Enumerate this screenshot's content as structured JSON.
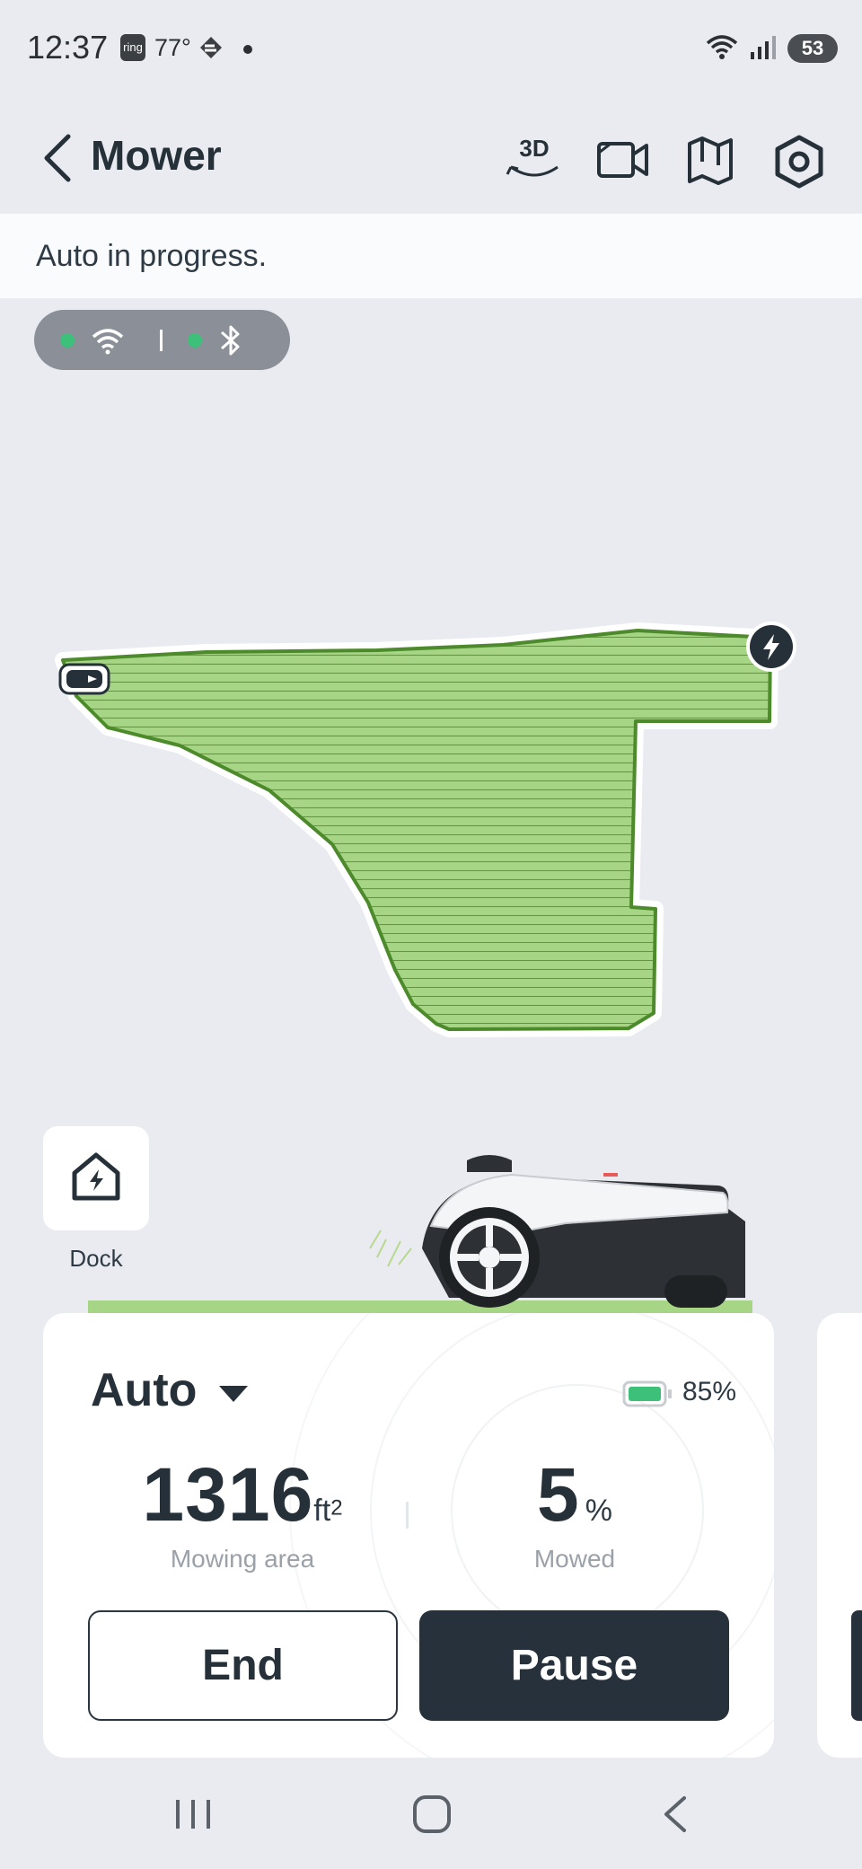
{
  "status_bar": {
    "time": "12:37",
    "ring_badge": "ring",
    "temperature": "77°",
    "battery": "53",
    "icons": [
      "ring-icon",
      "weather-icon",
      "wifi-icon",
      "signal-icon"
    ]
  },
  "header": {
    "title": "Mower",
    "actions": [
      "back-icon",
      "3d-view-icon",
      "camera-icon",
      "map-icon",
      "settings-icon"
    ],
    "three_d_label": "3D"
  },
  "banner": {
    "text": "Auto in progress."
  },
  "connectivity": {
    "wifi": "connected",
    "bluetooth": "connected",
    "status_color": "#3cc07a"
  },
  "map": {
    "lawn_color": "#a6d585",
    "border_color": "#4d8a2c"
  },
  "dock": {
    "label": "Dock"
  },
  "control_card": {
    "mode": "Auto",
    "battery_percent": "85%",
    "battery_level": 0.85,
    "mowing_area_value": "1316",
    "mowing_area_unit": "ft",
    "mowing_area_exp": "2",
    "mowing_area_caption": "Mowing area",
    "mowed_value": "5",
    "mowed_unit": "%",
    "mowed_caption": "Mowed",
    "end_label": "End",
    "pause_label": "Pause"
  },
  "nav_bar": {
    "items": [
      "recents-icon",
      "home-icon",
      "back-icon"
    ]
  },
  "colors": {
    "accent_dark": "#26313b",
    "background": "#e9ebf0",
    "grass": "#a6d585",
    "battery_green": "#3cc07a"
  }
}
